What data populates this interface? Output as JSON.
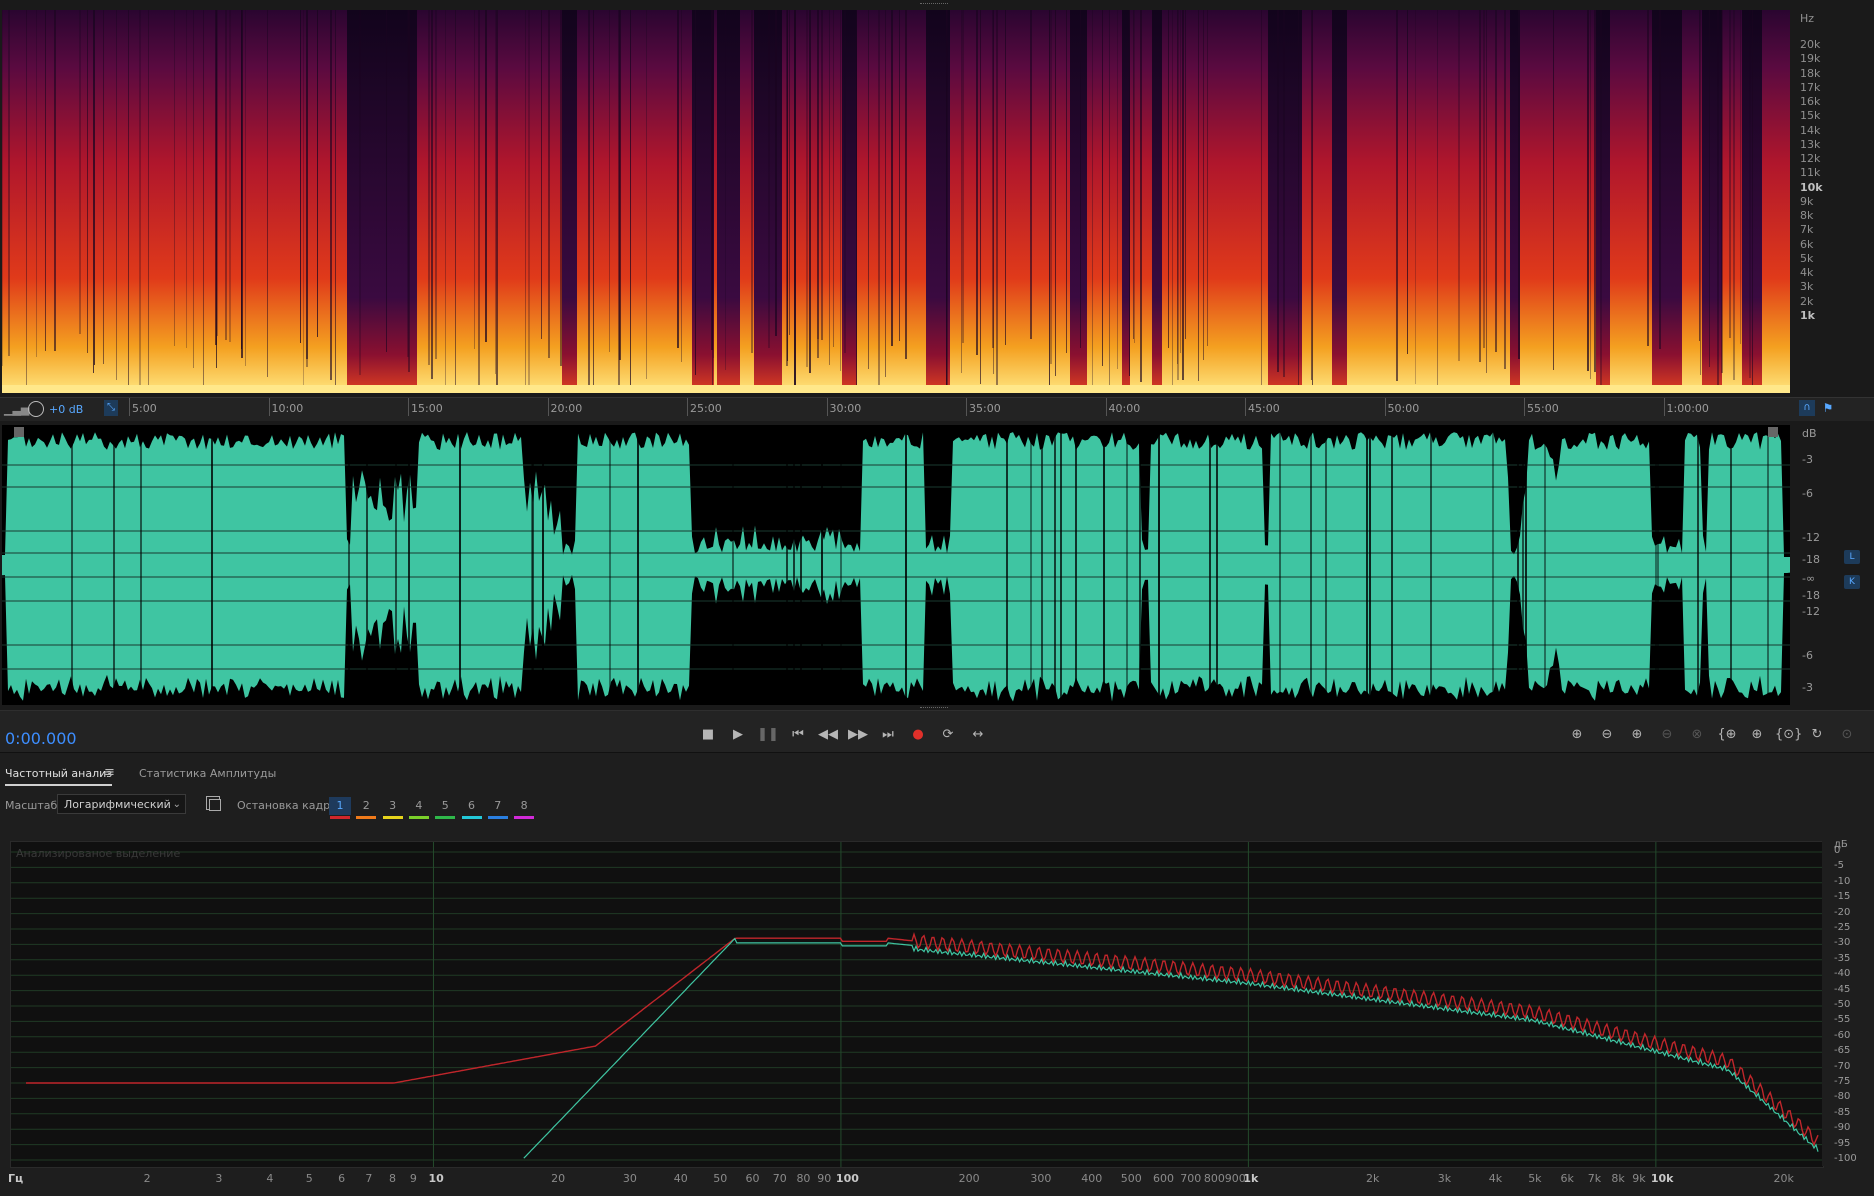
{
  "spectral": {
    "hz_unit": "Hz",
    "hz_ticks": [
      "20k",
      "19k",
      "18k",
      "17k",
      "16k",
      "15k",
      "14k",
      "13k",
      "12k",
      "11k",
      "10k",
      "9k",
      "8k",
      "7k",
      "6k",
      "5k",
      "4k",
      "3k",
      "2k",
      "1k"
    ]
  },
  "timeline": {
    "volume_label": "+0 dB",
    "ticks": [
      "5:00",
      "10:00",
      "15:00",
      "20:00",
      "25:00",
      "30:00",
      "35:00",
      "40:00",
      "45:00",
      "50:00",
      "55:00",
      "1:00:00"
    ]
  },
  "waveform": {
    "db_unit": "dB",
    "db_ticks": [
      "-3",
      "-6",
      "-12",
      "-18",
      "-∞",
      "-18",
      "-12",
      "-6",
      "-3"
    ],
    "channel_left": "L",
    "channel_right": "K",
    "wave_color": "#3fc5a2"
  },
  "transport": {
    "current_time": "0:00.000",
    "buttons": [
      "stop-icon",
      "play-icon",
      "pause-icon",
      "go-to-start-icon",
      "rewind-icon",
      "fast-forward-icon",
      "go-to-end-icon",
      "record-icon",
      "loop-icon",
      "skip-selection-icon"
    ],
    "record_color": "#e0302a"
  },
  "freq_analysis": {
    "tab_active": "Частотный анализ",
    "tab_other": "Статистика Амплитуды",
    "scale_label": "Масштаб:",
    "scale_value": "Логарифмический",
    "frame_label": "Остановка кадра:",
    "frames": [
      {
        "label": "1",
        "color": "#d0262b"
      },
      {
        "label": "2",
        "color": "#f07a1a"
      },
      {
        "label": "3",
        "color": "#e6d41c"
      },
      {
        "label": "4",
        "color": "#7bd02a"
      },
      {
        "label": "5",
        "color": "#2fb84a"
      },
      {
        "label": "6",
        "color": "#23c8d8"
      },
      {
        "label": "7",
        "color": "#2a7fe0"
      },
      {
        "label": "8",
        "color": "#d12ad8"
      }
    ],
    "graph_caption": "Анализированое выделение",
    "db_unit": "дБ",
    "db_ticks": [
      "0",
      "-5",
      "-10",
      "-15",
      "-20",
      "-25",
      "-30",
      "-35",
      "-40",
      "-45",
      "-50",
      "-55",
      "-60",
      "-65",
      "-70",
      "-75",
      "-80",
      "-85",
      "-90",
      "-95",
      "-100"
    ],
    "hz_unit": "Гц",
    "hz_ticks": [
      {
        "label": "2",
        "major": false
      },
      {
        "label": "3",
        "major": false
      },
      {
        "label": "4",
        "major": false
      },
      {
        "label": "5",
        "major": false
      },
      {
        "label": "6",
        "major": false
      },
      {
        "label": "7",
        "major": false
      },
      {
        "label": "8",
        "major": false
      },
      {
        "label": "9",
        "major": false
      },
      {
        "label": "10",
        "major": true
      },
      {
        "label": "20",
        "major": false
      },
      {
        "label": "30",
        "major": false
      },
      {
        "label": "40",
        "major": false
      },
      {
        "label": "50",
        "major": false
      },
      {
        "label": "60",
        "major": false
      },
      {
        "label": "70",
        "major": false
      },
      {
        "label": "80",
        "major": false
      },
      {
        "label": "90",
        "major": false
      },
      {
        "label": "100",
        "major": true
      },
      {
        "label": "200",
        "major": false
      },
      {
        "label": "300",
        "major": false
      },
      {
        "label": "400",
        "major": false
      },
      {
        "label": "500",
        "major": false
      },
      {
        "label": "600",
        "major": false
      },
      {
        "label": "700",
        "major": false
      },
      {
        "label": "800",
        "major": false
      },
      {
        "label": "900",
        "major": false
      },
      {
        "label": "1k",
        "major": true
      },
      {
        "label": "2k",
        "major": false
      },
      {
        "label": "3k",
        "major": false
      },
      {
        "label": "4k",
        "major": false
      },
      {
        "label": "5k",
        "major": false
      },
      {
        "label": "6k",
        "major": false
      },
      {
        "label": "7k",
        "major": false
      },
      {
        "label": "8k",
        "major": false
      },
      {
        "label": "9k",
        "major": false
      },
      {
        "label": "10k",
        "major": true
      },
      {
        "label": "20k",
        "major": false
      }
    ],
    "curve_red_color": "#c0262b",
    "curve_green_color": "#3fc5a2"
  }
}
